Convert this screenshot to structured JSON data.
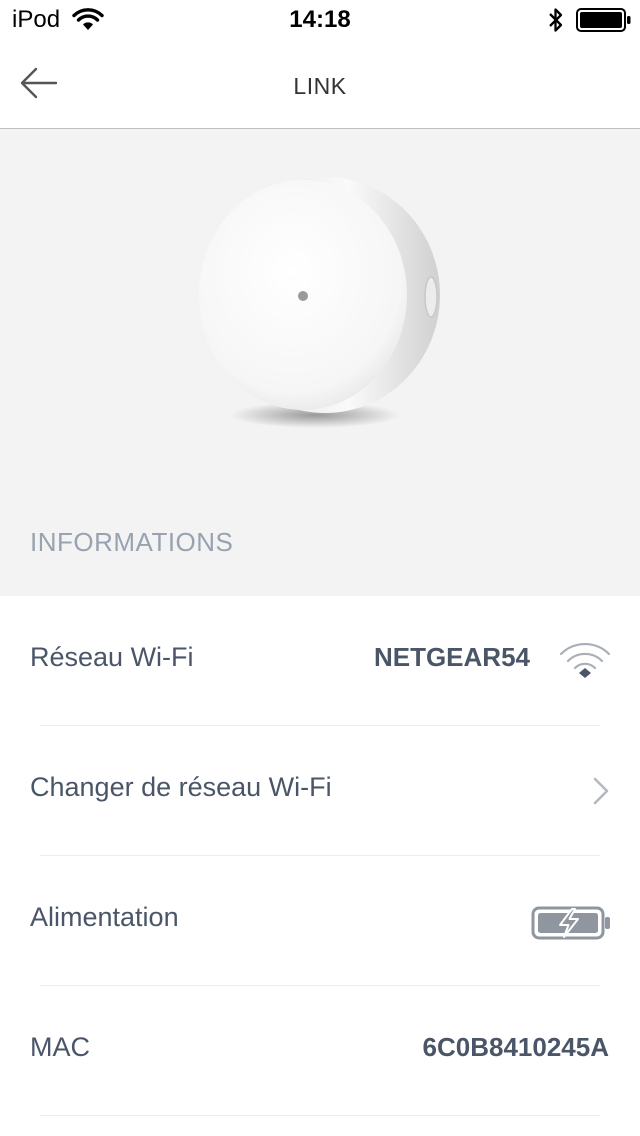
{
  "status_bar": {
    "carrier": "iPod",
    "time": "14:18",
    "icons": [
      "wifi-icon",
      "bluetooth-icon",
      "battery-icon"
    ]
  },
  "nav": {
    "title": "LINK",
    "back_icon": "arrow-left-icon"
  },
  "hero": {
    "image": "round-white-device",
    "section_header": "INFORMATIONS"
  },
  "info": {
    "wifi_network": {
      "label": "Réseau Wi-Fi",
      "value": "NETGEAR54",
      "icon": "wifi-signal-icon"
    },
    "change_network": {
      "label": "Changer de réseau Wi-Fi",
      "icon": "chevron-right-icon"
    },
    "power": {
      "label": "Alimentation",
      "icon": "battery-charging-icon"
    },
    "mac": {
      "label": "MAC",
      "value": "6C0B8410245A"
    }
  },
  "colors": {
    "text": "#4a5668",
    "section_header": "#98a3b1",
    "hero_background": "#f3f3f3",
    "divider": "#ececec"
  }
}
